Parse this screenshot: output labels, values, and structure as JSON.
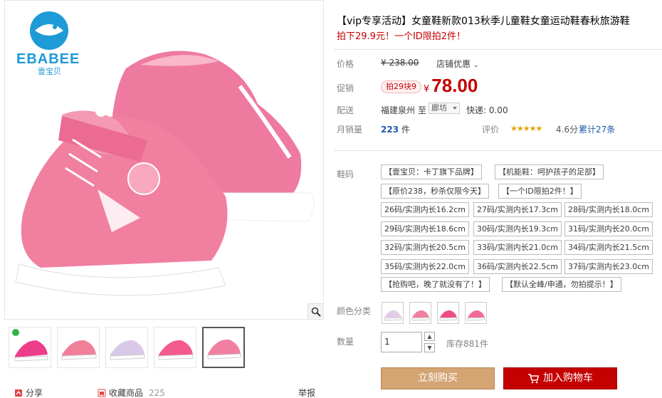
{
  "brand": {
    "name": "EBABEE",
    "name_cn": "壹宝贝"
  },
  "product": {
    "title": "【vip专享活动】女童鞋新款013秋季儿童鞋女童运动鞋春秋旅游鞋",
    "subtitle": "拍下29.9元！一个ID限拍2件！",
    "price_label": "价格",
    "price_old": "¥ 238.00",
    "shop_promo": "店铺优惠",
    "promo_label": "促销",
    "promo_tag": "拍29块9",
    "currency": "¥",
    "price_now": "78.00",
    "ship_label": "配送",
    "ship_from": "福建泉州",
    "ship_to_word": "至",
    "ship_to": "廊坊",
    "express": "快递: 0.00",
    "monthly_label": "月销量",
    "monthly_sales": "223",
    "monthly_unit": "件",
    "rating_label": "评价",
    "rating_stars": 4.6,
    "rating_score": "4.6分",
    "reviews": "累计27条"
  },
  "sku": {
    "size_label": "鞋码",
    "notes": [
      "【壹宝贝：卡丁旗下品牌】",
      "【机能鞋：呵护孩子的足部】",
      "【原价238，秒杀仅限今天】",
      "【一个ID限拍2件！】"
    ],
    "sizes": [
      "26码/实测内长16.2cm",
      "27码/实测内长17.3cm",
      "28码/实测内长18.0cm",
      "29码/实测内长18.6cm",
      "30码/实测内长19.3cm",
      "31码/实测内长20.0cm",
      "32码/实测内长20.5cm",
      "33码/实测内长21.0cm",
      "34码/实测内长21.5cm",
      "35码/实测内长22.0cm",
      "36码/实测内长22.5cm",
      "37码/实测内长23.0cm"
    ],
    "tail_notes": [
      "【抢购吧，晚了就没有了！】",
      "【默认全峰/申通，勿拍提示！】"
    ],
    "color_label": "颜色分类",
    "colors": [
      "light-pink",
      "pink",
      "pink-red",
      "pink-white"
    ]
  },
  "quantity": {
    "label": "数量",
    "value": "1",
    "stock": "库存881件"
  },
  "actions": {
    "buy_now": "立刻购买",
    "add_cart": "加入购物车"
  },
  "footer": {
    "share": "分享",
    "favorite": "收藏商品",
    "favorite_count": "225",
    "report": "举报"
  },
  "colors": {
    "accent_red": "#c40000",
    "buy_tan": "#d4a473",
    "shoe_pink": "#f07fa0",
    "logo_blue": "#1e9ad6"
  }
}
